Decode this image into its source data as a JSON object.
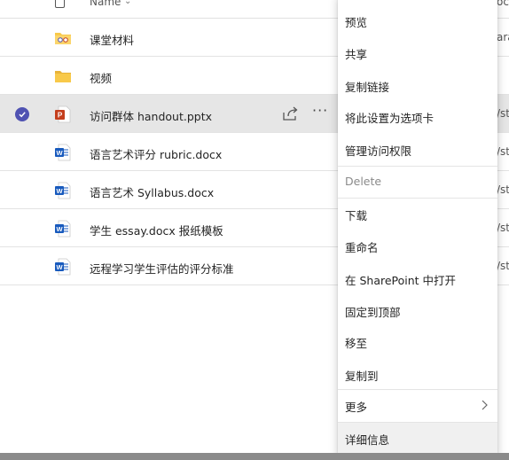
{
  "list": {
    "header": {
      "name_label": "Name",
      "right_label": "oc"
    },
    "rows": [
      {
        "name": "课堂材料",
        "icon": "class-materials-folder-icon",
        "right": "ara"
      },
      {
        "name": "视频",
        "icon": "folder-icon",
        "right": ""
      },
      {
        "name": "访问群体 handout.pptx",
        "icon": "powerpoint-icon",
        "right": "/st",
        "selected": true
      },
      {
        "name": "语言艺术评分 rubric.docx",
        "icon": "word-icon",
        "right": "/st"
      },
      {
        "name": "语言艺术 Syllabus.docx",
        "icon": "word-icon",
        "right": "/st"
      },
      {
        "name": "学生 essay.docx 报纸模板",
        "icon": "word-icon",
        "right": "/st"
      },
      {
        "name": "远程学习学生评估的评分标准",
        "icon": "word-icon",
        "right": "/st"
      }
    ],
    "selected_actions": {
      "more_label": "···"
    }
  },
  "context_menu": {
    "items": [
      {
        "label": "预览"
      },
      {
        "label": "共享"
      },
      {
        "label": "复制链接"
      },
      {
        "label": "将此设置为选项卡"
      },
      {
        "label": "管理访问权限"
      },
      {
        "label": "Delete",
        "disabled": true
      },
      {
        "label": "下载"
      },
      {
        "label": "重命名"
      },
      {
        "label": "在 SharePoint 中打开"
      },
      {
        "label": "固定到顶部"
      },
      {
        "label": "移至"
      },
      {
        "label": "复制到"
      },
      {
        "label": "更多",
        "has_submenu": true
      },
      {
        "label": "详细信息",
        "hover": true
      }
    ]
  },
  "colors": {
    "accent": "#4f52b2",
    "selected_row": "#e6e6e6",
    "word_blue": "#185abd",
    "ppt_red": "#c43e1c",
    "folder_yellow": "#f8c94a"
  }
}
